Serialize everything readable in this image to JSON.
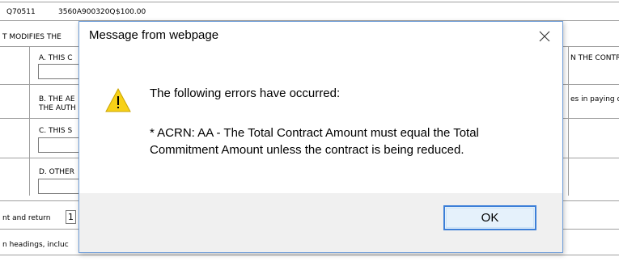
{
  "background": {
    "top_row": {
      "code": "Q70511",
      "id": "3560A900320Q",
      "amount": "$100.00"
    },
    "modifies_line": "T MODIFIES THE",
    "item_a": "A. THIS C",
    "item_a_right": "N THE CONTRA",
    "item_b_line1": "B. THE AE",
    "item_b_line2": "THE AUTH",
    "item_b_right": "es in paying o",
    "item_c": "C. THIS S",
    "item_d": "D. OTHER",
    "return_label": "nt and return",
    "return_value": "1",
    "headings_label": "n headings, incluc"
  },
  "dialog": {
    "title": "Message from webpage",
    "close_icon": "close-icon",
    "warning_icon": "warning-icon",
    "heading": "The following errors have occurred:",
    "body": "* ACRN: AA - The Total Contract Amount must equal the Total Commitment Amount unless the contract is being reduced.",
    "ok_label": "OK",
    "colors": {
      "border": "#6f9dd8",
      "footer": "#f0f0f0",
      "ok_border": "#3c7fd8",
      "ok_fill": "#e5f1fb",
      "warning_fill": "#f7d117"
    }
  }
}
